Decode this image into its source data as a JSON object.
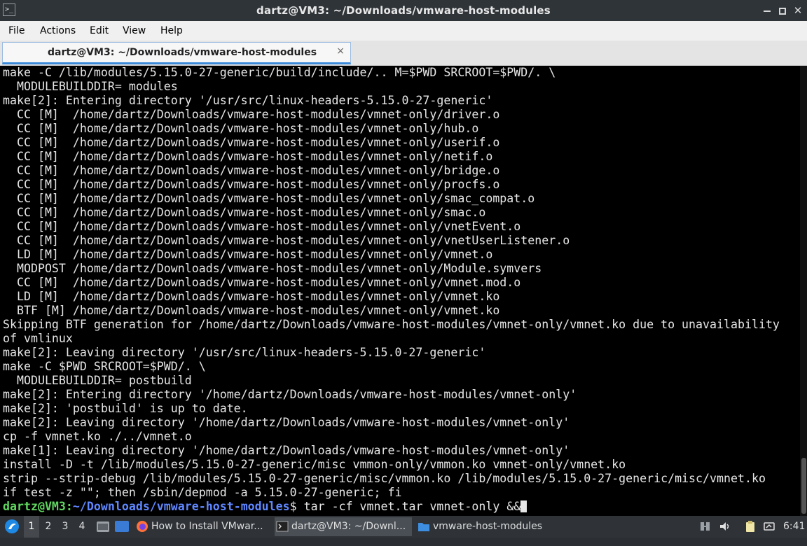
{
  "window": {
    "title": "dartz@VM3: ~/Downloads/vmware-host-modules",
    "icon": "terminal-icon",
    "controls": [
      "minimize-icon",
      "maximize-icon",
      "close-icon"
    ]
  },
  "menubar": {
    "items": [
      {
        "label": "File"
      },
      {
        "label": "Actions"
      },
      {
        "label": "Edit"
      },
      {
        "label": "View"
      },
      {
        "label": "Help"
      }
    ]
  },
  "tab": {
    "label": "dartz@VM3: ~/Downloads/vmware-host-modules",
    "close_glyph": "×"
  },
  "terminal": {
    "lines": [
      "make -C /lib/modules/5.15.0-27-generic/build/include/.. M=$PWD SRCROOT=$PWD/. \\",
      "  MODULEBUILDDIR= modules",
      "make[2]: Entering directory '/usr/src/linux-headers-5.15.0-27-generic'",
      "  CC [M]  /home/dartz/Downloads/vmware-host-modules/vmnet-only/driver.o",
      "  CC [M]  /home/dartz/Downloads/vmware-host-modules/vmnet-only/hub.o",
      "  CC [M]  /home/dartz/Downloads/vmware-host-modules/vmnet-only/userif.o",
      "  CC [M]  /home/dartz/Downloads/vmware-host-modules/vmnet-only/netif.o",
      "  CC [M]  /home/dartz/Downloads/vmware-host-modules/vmnet-only/bridge.o",
      "  CC [M]  /home/dartz/Downloads/vmware-host-modules/vmnet-only/procfs.o",
      "  CC [M]  /home/dartz/Downloads/vmware-host-modules/vmnet-only/smac_compat.o",
      "  CC [M]  /home/dartz/Downloads/vmware-host-modules/vmnet-only/smac.o",
      "  CC [M]  /home/dartz/Downloads/vmware-host-modules/vmnet-only/vnetEvent.o",
      "  CC [M]  /home/dartz/Downloads/vmware-host-modules/vmnet-only/vnetUserListener.o",
      "  LD [M]  /home/dartz/Downloads/vmware-host-modules/vmnet-only/vmnet.o",
      "  MODPOST /home/dartz/Downloads/vmware-host-modules/vmnet-only/Module.symvers",
      "  CC [M]  /home/dartz/Downloads/vmware-host-modules/vmnet-only/vmnet.mod.o",
      "  LD [M]  /home/dartz/Downloads/vmware-host-modules/vmnet-only/vmnet.ko",
      "  BTF [M] /home/dartz/Downloads/vmware-host-modules/vmnet-only/vmnet.ko",
      "Skipping BTF generation for /home/dartz/Downloads/vmware-host-modules/vmnet-only/vmnet.ko due to unavailability",
      "of vmlinux",
      "make[2]: Leaving directory '/usr/src/linux-headers-5.15.0-27-generic'",
      "make -C $PWD SRCROOT=$PWD/. \\",
      "  MODULEBUILDDIR= postbuild",
      "make[2]: Entering directory '/home/dartz/Downloads/vmware-host-modules/vmnet-only'",
      "make[2]: 'postbuild' is up to date.",
      "make[2]: Leaving directory '/home/dartz/Downloads/vmware-host-modules/vmnet-only'",
      "cp -f vmnet.ko ./../vmnet.o",
      "make[1]: Leaving directory '/home/dartz/Downloads/vmware-host-modules/vmnet-only'",
      "install -D -t /lib/modules/5.15.0-27-generic/misc vmmon-only/vmmon.ko vmnet-only/vmnet.ko",
      "strip --strip-debug /lib/modules/5.15.0-27-generic/misc/vmmon.ko /lib/modules/5.15.0-27-generic/misc/vmnet.ko",
      "if test -z \"\"; then /sbin/depmod -a 5.15.0-27-generic; fi"
    ],
    "prompt": {
      "user_host": "dartz@VM3",
      "colon": ":",
      "path": "~/Downloads/vmware-host-modules",
      "symbol": "$",
      "command": " tar -cf vmnet.tar vmnet-only &&"
    },
    "colors": {
      "prompt_user": "#5fd75f",
      "prompt_path": "#5f87ff",
      "text": "#e6e6e6"
    }
  },
  "taskbar": {
    "start_icon": "lubuntu-menu-icon",
    "desktops": [
      "1",
      "2",
      "3",
      "4"
    ],
    "active_desktop": "1",
    "quicklaunch": [
      "file-manager-icon",
      "show-desktop-icon"
    ],
    "tasks": [
      {
        "label": "How to Install VMwar...",
        "icon": "firefox-icon"
      },
      {
        "label": "dartz@VM3: ~/Downl...",
        "icon": "terminal-icon"
      },
      {
        "label": "vmware-host-modules",
        "icon": "folder-icon"
      }
    ],
    "tray": [
      "network-icon",
      "volume-icon",
      "clipboard-icon",
      "battery-icon"
    ],
    "clock": "6:41"
  }
}
